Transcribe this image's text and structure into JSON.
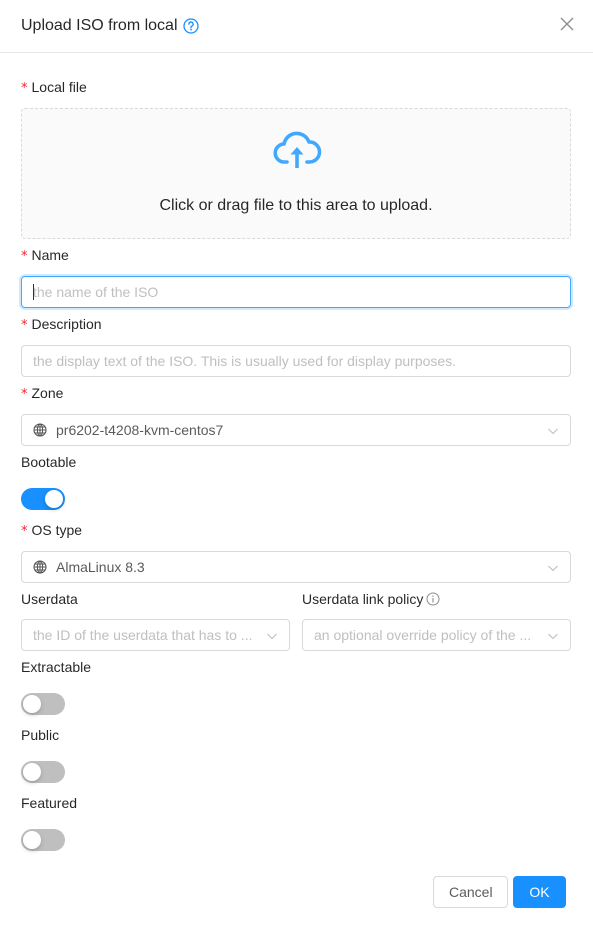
{
  "dialog": {
    "title": "Upload ISO from local",
    "colors": {
      "primary": "#1890ff",
      "required": "#f5222d"
    }
  },
  "form": {
    "local_file": {
      "label": "Local file",
      "required": true,
      "drop_hint": "Click or drag file to this area to upload."
    },
    "name": {
      "label": "Name",
      "required": true,
      "value": "",
      "placeholder": "the name of the ISO"
    },
    "description": {
      "label": "Description",
      "required": true,
      "value": "",
      "placeholder": "the display text of the ISO. This is usually used for display purposes."
    },
    "zone": {
      "label": "Zone",
      "required": true,
      "selected": "pr6202-t4208-kvm-centos7"
    },
    "bootable": {
      "label": "Bootable",
      "checked": true
    },
    "os_type": {
      "label": "OS type",
      "required": true,
      "selected": "AlmaLinux 8.3"
    },
    "userdata": {
      "label": "Userdata",
      "placeholder": "the ID of the userdata that has to ..."
    },
    "userdata_link_policy": {
      "label": "Userdata link policy",
      "placeholder": "an optional override policy of the ..."
    },
    "extractable": {
      "label": "Extractable",
      "checked": false
    },
    "public": {
      "label": "Public",
      "checked": false
    },
    "featured": {
      "label": "Featured",
      "checked": false
    }
  },
  "footer": {
    "cancel_label": "Cancel",
    "ok_label": "OK"
  }
}
